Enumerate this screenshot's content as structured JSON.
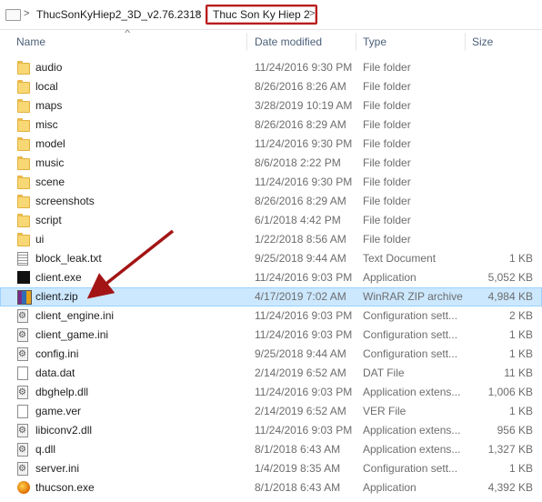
{
  "address_bar": {
    "crumbs": [
      "ThucSonKyHiep2_3D_v2.76.2318",
      "Thuc Son Ky Hiep 2"
    ],
    "separator": ">",
    "dropdown": "⌄"
  },
  "columns": {
    "name": "Name",
    "date": "Date modified",
    "type": "Type",
    "size": "Size",
    "sort_indicator": "^"
  },
  "files": [
    {
      "name": "audio",
      "date": "11/24/2016 9:30 PM",
      "type": "File folder",
      "size": "",
      "icon": "folder-icon"
    },
    {
      "name": "local",
      "date": "8/26/2016 8:26 AM",
      "type": "File folder",
      "size": "",
      "icon": "folder-icon"
    },
    {
      "name": "maps",
      "date": "3/28/2019 10:19 AM",
      "type": "File folder",
      "size": "",
      "icon": "folder-icon"
    },
    {
      "name": "misc",
      "date": "8/26/2016 8:29 AM",
      "type": "File folder",
      "size": "",
      "icon": "folder-icon"
    },
    {
      "name": "model",
      "date": "11/24/2016 9:30 PM",
      "type": "File folder",
      "size": "",
      "icon": "folder-icon"
    },
    {
      "name": "music",
      "date": "8/6/2018 2:22 PM",
      "type": "File folder",
      "size": "",
      "icon": "folder-icon"
    },
    {
      "name": "scene",
      "date": "11/24/2016 9:30 PM",
      "type": "File folder",
      "size": "",
      "icon": "folder-icon"
    },
    {
      "name": "screenshots",
      "date": "8/26/2016 8:29 AM",
      "type": "File folder",
      "size": "",
      "icon": "folder-icon"
    },
    {
      "name": "script",
      "date": "6/1/2018 4:42 PM",
      "type": "File folder",
      "size": "",
      "icon": "folder-icon"
    },
    {
      "name": "ui",
      "date": "1/22/2018 8:56 AM",
      "type": "File folder",
      "size": "",
      "icon": "folder-icon"
    },
    {
      "name": "block_leak.txt",
      "date": "9/25/2018 9:44 AM",
      "type": "Text Document",
      "size": "1 KB",
      "icon": "text-file-icon"
    },
    {
      "name": "client.exe",
      "date": "11/24/2016 9:03 PM",
      "type": "Application",
      "size": "5,052 KB",
      "icon": "exe-icon"
    },
    {
      "name": "client.zip",
      "date": "4/17/2019 7:02 AM",
      "type": "WinRAR ZIP archive",
      "size": "4,984 KB",
      "icon": "winrar-icon",
      "selected": true
    },
    {
      "name": "client_engine.ini",
      "date": "11/24/2016 9:03 PM",
      "type": "Configuration sett...",
      "size": "2 KB",
      "icon": "config-file-icon"
    },
    {
      "name": "client_game.ini",
      "date": "11/24/2016 9:03 PM",
      "type": "Configuration sett...",
      "size": "1 KB",
      "icon": "config-file-icon"
    },
    {
      "name": "config.ini",
      "date": "9/25/2018 9:44 AM",
      "type": "Configuration sett...",
      "size": "1 KB",
      "icon": "config-file-icon"
    },
    {
      "name": "data.dat",
      "date": "2/14/2019 6:52 AM",
      "type": "DAT File",
      "size": "11 KB",
      "icon": "blank-file-icon"
    },
    {
      "name": "dbghelp.dll",
      "date": "11/24/2016 9:03 PM",
      "type": "Application extens...",
      "size": "1,006 KB",
      "icon": "dll-file-icon"
    },
    {
      "name": "game.ver",
      "date": "2/14/2019 6:52 AM",
      "type": "VER File",
      "size": "1 KB",
      "icon": "blank-file-icon"
    },
    {
      "name": "libiconv2.dll",
      "date": "11/24/2016 9:03 PM",
      "type": "Application extens...",
      "size": "956 KB",
      "icon": "dll-file-icon"
    },
    {
      "name": "q.dll",
      "date": "8/1/2018 6:43 AM",
      "type": "Application extens...",
      "size": "1,327 KB",
      "icon": "dll-file-icon"
    },
    {
      "name": "server.ini",
      "date": "1/4/2019 8:35 AM",
      "type": "Configuration sett...",
      "size": "1 KB",
      "icon": "config-file-icon"
    },
    {
      "name": "thucson.exe",
      "date": "8/1/2018 6:43 AM",
      "type": "Application",
      "size": "4,392 KB",
      "icon": "game-app-icon"
    }
  ],
  "colors": {
    "selection_bg": "#cce8ff",
    "highlight_border": "#b71c1c",
    "arrow": "#a31515"
  }
}
